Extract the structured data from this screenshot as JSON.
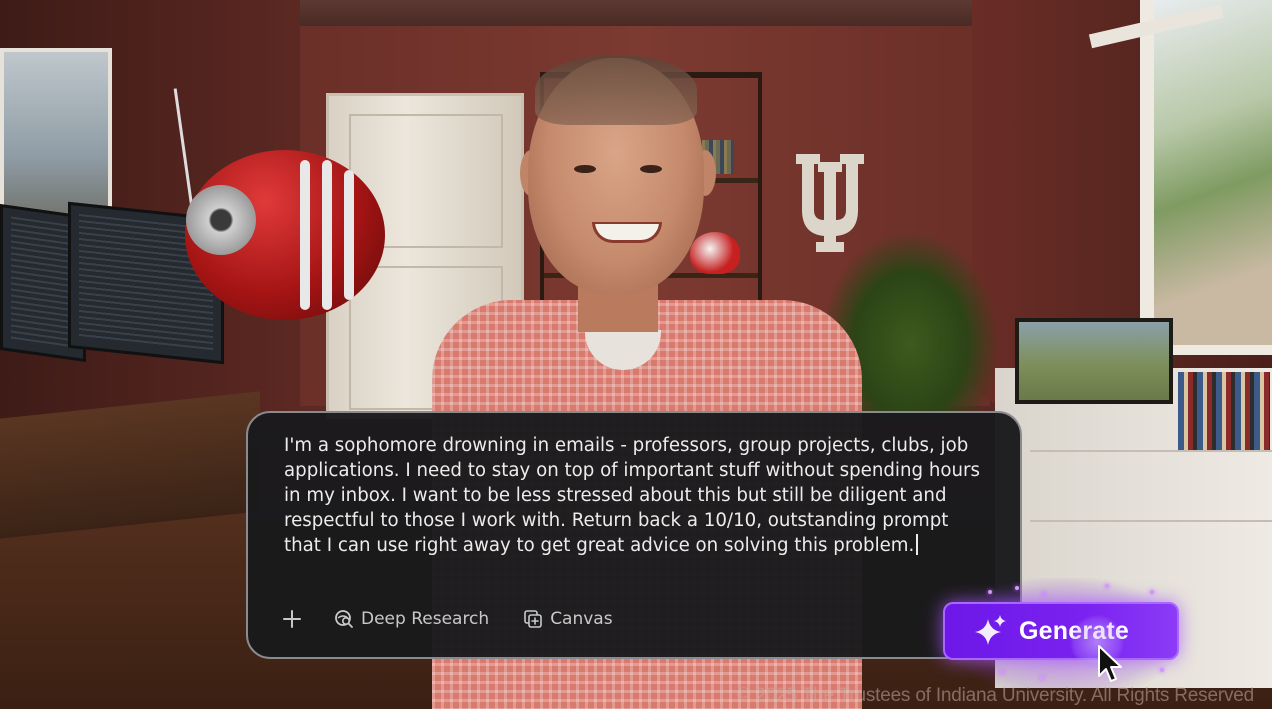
{
  "prompt": {
    "text": "I'm a sophomore drowning in emails - professors, group projects, clubs, job\napplications. I need to stay on top of important stuff without spending hours\nin my inbox. I want to be less stressed about this but still be diligent and\nrespectful to those I work with. Return back a 10/10, outstanding prompt\nthat I can use right away to get great advice on solving this problem."
  },
  "toolbar": {
    "plus_icon": "plus-icon",
    "deep_research_label": "Deep Research",
    "deep_research_icon": "search-globe-icon",
    "canvas_label": "Canvas",
    "canvas_icon": "canvas-add-icon"
  },
  "generate": {
    "label": "Generate",
    "icon": "sparkle-icon",
    "color": "#7a22f0"
  },
  "footer": {
    "copyright": "© 2025 The Trustees of Indiana University. All Rights Reserved"
  },
  "scene": {
    "logo_text": "ΨU"
  }
}
